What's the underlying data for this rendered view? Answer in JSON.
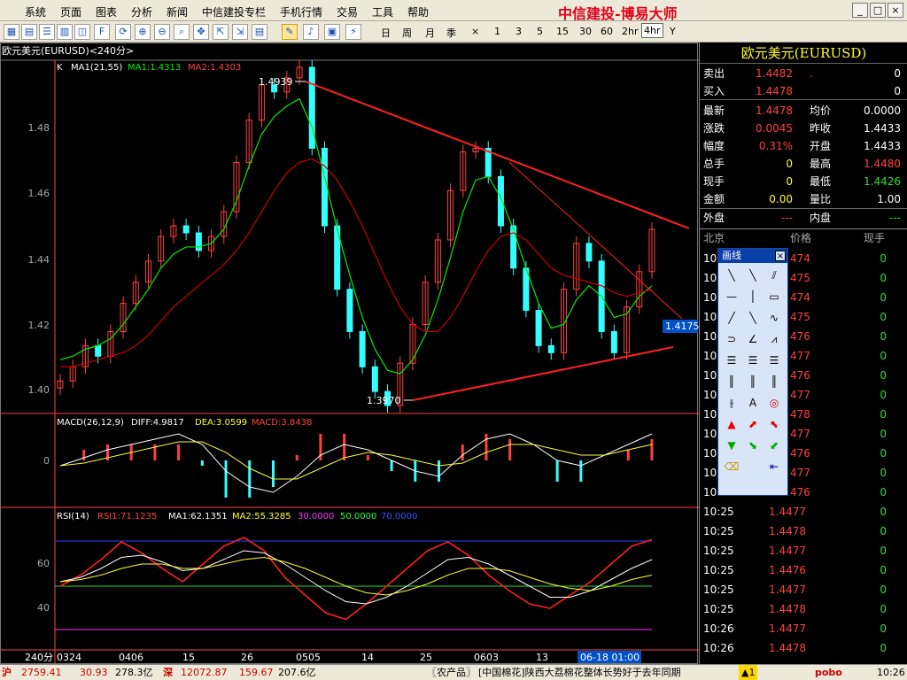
{
  "menu": {
    "items": [
      "系统",
      "页面",
      "图表",
      "分析",
      "新闻",
      "中信建投专栏",
      "手机行情",
      "交易",
      "工具",
      "帮助"
    ],
    "brand": "中信建投-博易大师",
    "window_buttons": [
      "_",
      "□",
      "×"
    ]
  },
  "toolbar": {
    "periods": [
      "日",
      "周",
      "月",
      "季",
      "×",
      "1",
      "3",
      "5",
      "15",
      "30",
      "60",
      "2hr",
      "4hr",
      "Y"
    ],
    "active_period": "4hr"
  },
  "chart": {
    "title": "欧元美元(EURUSD)<240分>",
    "main_legend": {
      "k": "K",
      "ma": "MA1(21,55)",
      "ma1": "MA1:1.4313",
      "ma2": "MA2:1.4303"
    },
    "macd_legend": {
      "name": "MACD(26,12,9)",
      "diff": "DIFF:4.9817",
      "dea": "DEA:3.0599",
      "macd": "MACD:3.8438"
    },
    "rsi_legend": {
      "name": "RSI(14)",
      "rsi1": "RSI1:71.1235",
      "ma1": "MA1:62.1351",
      "ma2": "MA2:55.3285",
      "l30": "30.0000",
      "l50": "50.0000",
      "l70": "70.0000"
    },
    "high_label": "1.4939",
    "low_label": "1.3970",
    "current_label": "1.4175",
    "price_ticks": [
      "1.48",
      "1.46",
      "1.44",
      "1.42",
      "1.40"
    ],
    "macd_ticks": [
      "0"
    ],
    "rsi_ticks": [
      "60",
      "40"
    ],
    "x_prefix": "240分",
    "x_labels": [
      "0324",
      "0406",
      "15",
      "26",
      "0505",
      "14",
      "25",
      "0603",
      "13"
    ],
    "cursor_date": "06-18 01:00"
  },
  "chart_data": {
    "type": "line",
    "series": [
      {
        "name": "K",
        "values": [
          1.404,
          1.408,
          1.414,
          1.411,
          1.418,
          1.426,
          1.432,
          1.438,
          1.445,
          1.448,
          1.446,
          1.441,
          1.445,
          1.452,
          1.466,
          1.478,
          1.488,
          1.486,
          1.49,
          1.493,
          1.47,
          1.448,
          1.43,
          1.418,
          1.408,
          1.401,
          1.397,
          1.409,
          1.42,
          1.432,
          1.444,
          1.458,
          1.469,
          1.47,
          1.462,
          1.448,
          1.436,
          1.424,
          1.414,
          1.412,
          1.43,
          1.443,
          1.438,
          1.418,
          1.412,
          1.425,
          1.435,
          1.447
        ]
      },
      {
        "name": "MA1",
        "values": [
          1.41,
          1.411,
          1.413,
          1.414,
          1.416,
          1.42,
          1.425,
          1.43,
          1.436,
          1.44,
          1.442,
          1.442,
          1.443,
          1.447,
          1.455,
          1.465,
          1.474,
          1.479,
          1.482,
          1.484,
          1.476,
          1.462,
          1.447,
          1.434,
          1.422,
          1.413,
          1.407,
          1.406,
          1.41,
          1.417,
          1.427,
          1.439,
          1.452,
          1.461,
          1.462,
          1.456,
          1.447,
          1.436,
          1.426,
          1.419,
          1.42,
          1.427,
          1.431,
          1.428,
          1.422,
          1.423,
          1.428,
          1.431
        ]
      },
      {
        "name": "MA2",
        "values": [
          1.408,
          1.408,
          1.409,
          1.41,
          1.411,
          1.412,
          1.414,
          1.417,
          1.421,
          1.425,
          1.428,
          1.431,
          1.434,
          1.437,
          1.441,
          1.446,
          1.452,
          1.458,
          1.463,
          1.466,
          1.467,
          1.465,
          1.461,
          1.455,
          1.448,
          1.44,
          1.432,
          1.425,
          1.42,
          1.418,
          1.418,
          1.422,
          1.428,
          1.435,
          1.441,
          1.445,
          1.446,
          1.444,
          1.44,
          1.436,
          1.434,
          1.433,
          1.432,
          1.431,
          1.429,
          1.428,
          1.429,
          1.43
        ]
      }
    ],
    "ylim": [
      1.395,
      1.495
    ],
    "trendlines": [
      {
        "from": [
          1.4939
        ],
        "to": [
          1.45
        ]
      },
      {
        "from": [
          1.397
        ],
        "to": [
          1.412
        ]
      }
    ],
    "macd": {
      "diff": [
        -1,
        0.5,
        2,
        3,
        4,
        5,
        3,
        -2,
        -5,
        -6,
        -3,
        1,
        3,
        2,
        0,
        -2,
        -3,
        1,
        4,
        5,
        3,
        0,
        -1,
        1,
        3,
        5
      ],
      "dea": [
        -1,
        -0.5,
        0.5,
        1.5,
        2.5,
        3.5,
        3.5,
        1.5,
        -1.5,
        -3.5,
        -3.5,
        -1.5,
        0.5,
        1.5,
        1,
        0,
        -1,
        -0.5,
        1.5,
        3,
        3,
        2,
        1,
        1,
        2,
        3
      ]
    },
    "rsi": {
      "rsi1": [
        50,
        55,
        62,
        70,
        65,
        58,
        52,
        60,
        68,
        72,
        66,
        54,
        46,
        38,
        35,
        42,
        50,
        58,
        66,
        70,
        64,
        55,
        48,
        42,
        40,
        46,
        52,
        60,
        68,
        71
      ],
      "ma1": [
        52,
        54,
        58,
        63,
        64,
        61,
        57,
        58,
        62,
        66,
        65,
        60,
        54,
        48,
        43,
        42,
        45,
        50,
        56,
        62,
        63,
        60,
        55,
        50,
        45,
        45,
        48,
        53,
        58,
        62
      ],
      "ma2": [
        52,
        53,
        55,
        58,
        60,
        60,
        58,
        58,
        60,
        62,
        63,
        61,
        58,
        54,
        50,
        47,
        46,
        48,
        51,
        55,
        58,
        58,
        57,
        54,
        51,
        49,
        48,
        50,
        53,
        55
      ],
      "lines": [
        30,
        50,
        70
      ]
    }
  },
  "quote": {
    "title": "欧元美元(EURUSD)",
    "rows": [
      {
        "l": "卖出",
        "v": "1.4482",
        "l2": ".",
        "v2": "0"
      },
      {
        "l": "买入",
        "v": "1.4478",
        "l2": "",
        "v2": "0"
      },
      {
        "l": "最新",
        "v": "1.4478",
        "l2": "均价",
        "v2": "0.0000"
      },
      {
        "l": "涨跌",
        "v": "0.0045",
        "l2": "昨收",
        "v2": "1.4433"
      },
      {
        "l": "幅度",
        "v": "0.31%",
        "l2": "开盘",
        "v2": "1.4433"
      },
      {
        "l": "总手",
        "v": "0",
        "l2": "最高",
        "v2": "1.4480"
      },
      {
        "l": "现手",
        "v": "0",
        "l2": "最低",
        "v2": "1.4426"
      },
      {
        "l": "金额",
        "v": "0.00",
        "l2": "量比",
        "v2": "1.00"
      },
      {
        "l": "外盘",
        "v": "---",
        "l2": "内盘",
        "v2": "---"
      }
    ],
    "tick_head": {
      "time": "北京",
      "price": "价格",
      "vol": "现手"
    },
    "ticks": [
      {
        "t": "10:",
        "p": "474",
        "v": "0"
      },
      {
        "t": "10:",
        "p": "475",
        "v": "0"
      },
      {
        "t": "10:",
        "p": "474",
        "v": "0"
      },
      {
        "t": "10:",
        "p": "475",
        "v": "0"
      },
      {
        "t": "10:",
        "p": "476",
        "v": "0"
      },
      {
        "t": "10:",
        "p": "477",
        "v": "0"
      },
      {
        "t": "10:",
        "p": "476",
        "v": "0"
      },
      {
        "t": "10:",
        "p": "477",
        "v": "0"
      },
      {
        "t": "10:",
        "p": "478",
        "v": "0"
      },
      {
        "t": "10:",
        "p": "477",
        "v": "0"
      },
      {
        "t": "10:",
        "p": "476",
        "v": "0"
      },
      {
        "t": "10:",
        "p": "477",
        "v": "0"
      },
      {
        "t": "10:",
        "p": "476",
        "v": "0"
      },
      {
        "t": "10:25",
        "p": "1.4477",
        "v": "0"
      },
      {
        "t": "10:25",
        "p": "1.4478",
        "v": "0"
      },
      {
        "t": "10:25",
        "p": "1.4477",
        "v": "0"
      },
      {
        "t": "10:25",
        "p": "1.4476",
        "v": "0"
      },
      {
        "t": "10:25",
        "p": "1.4477",
        "v": "0"
      },
      {
        "t": "10:25",
        "p": "1.4478",
        "v": "0"
      },
      {
        "t": "10:26",
        "p": "1.4477",
        "v": "0"
      },
      {
        "t": "10:26",
        "p": "1.4478",
        "v": "0"
      }
    ]
  },
  "draw_panel": {
    "title": "画线",
    "close": "×",
    "text_tool": "A"
  },
  "status": {
    "sh_label": "沪",
    "sh_value": "2759.41",
    "sh_change": "30.93",
    "sh_amount": "278.3亿",
    "sz_label": "深",
    "sz_value": "12072.87",
    "sz_change": "159.67",
    "sz_amount": "207.6亿",
    "news_tag": "〖农产品〗",
    "news": "[中国棉花]陕西大荔棉花整体长势好于去年同期",
    "alert": "▲1",
    "brand": "pobo",
    "time": "10:26"
  },
  "colors": {
    "up": "#ff4040",
    "down": "#33ffff",
    "ma1": "#00ee00",
    "ma2": "#cc0000",
    "trend": "#ff2020",
    "accent_title": "#ffff33"
  }
}
